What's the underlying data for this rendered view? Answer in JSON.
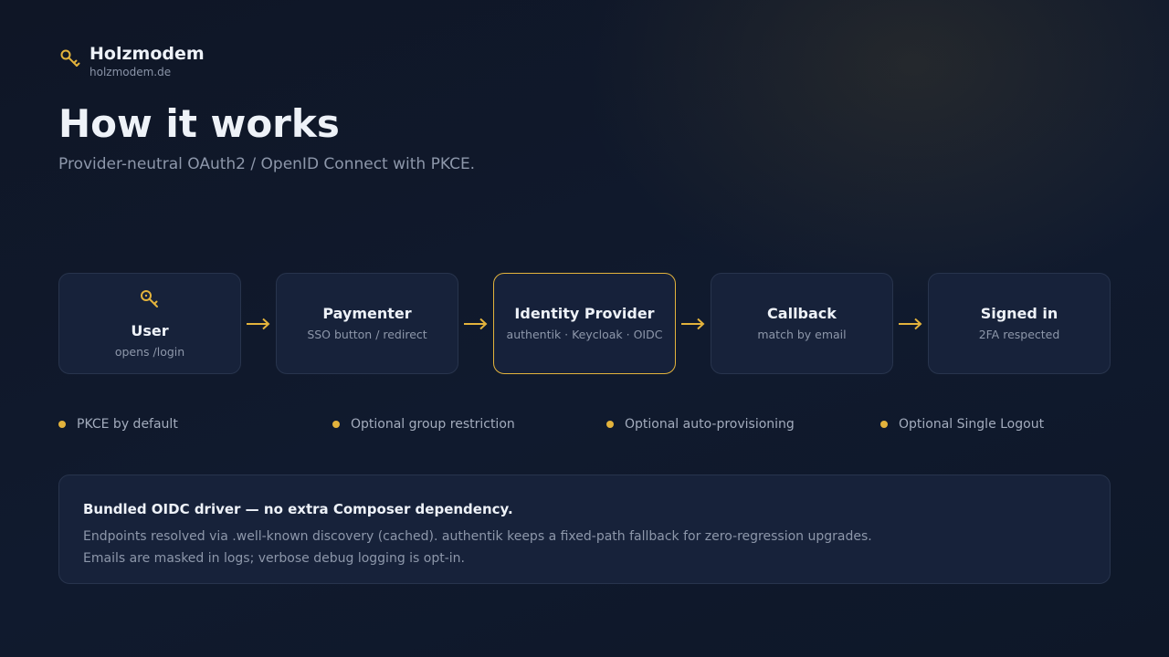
{
  "brand": {
    "name": "Holzmodem",
    "domain": "holzmodem.de",
    "icon": "key-icon"
  },
  "title": "How it works",
  "subtitle": "Provider-neutral OAuth2 / OpenID Connect with PKCE.",
  "flow": [
    {
      "title": "User",
      "sub": "opens /login",
      "icon": "key-icon"
    },
    {
      "title": "Paymenter",
      "sub": "SSO button / redirect"
    },
    {
      "title": "Identity Provider",
      "sub": "authentik · Keycloak · OIDC",
      "highlighted": true
    },
    {
      "title": "Callback",
      "sub": "match by email"
    },
    {
      "title": "Signed in",
      "sub": "2FA respected"
    }
  ],
  "features": [
    "PKCE by default",
    "Optional group restriction",
    "Optional auto-provisioning",
    "Optional Single Logout"
  ],
  "note": {
    "title": "Bundled OIDC driver — no extra Composer dependency.",
    "lines": [
      "Endpoints resolved via .well-known discovery (cached). authentik keeps a fixed-path fallback for zero-regression upgrades.",
      "Emails are masked in logs; verbose debug logging is opt-in."
    ]
  },
  "colors": {
    "accent": "#e3b33c",
    "card": "#17223a",
    "border": "#28344d",
    "background": "#0f1626"
  }
}
